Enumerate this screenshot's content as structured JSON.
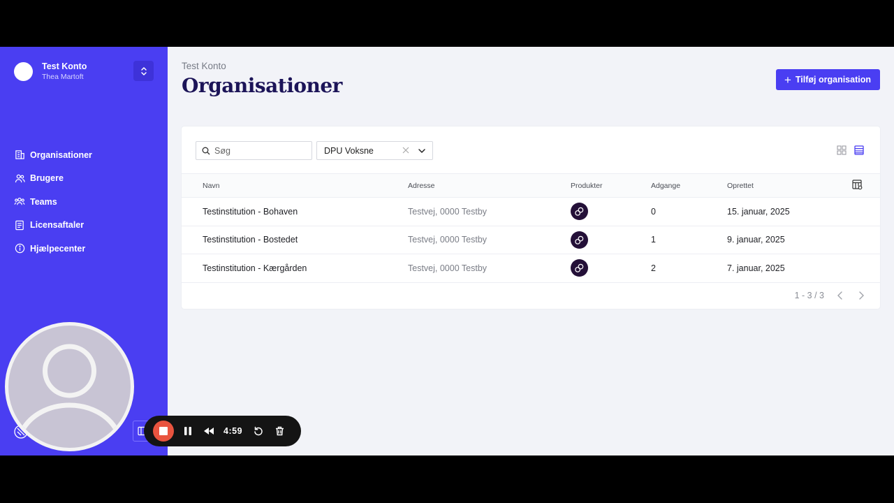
{
  "account": {
    "name": "Test Konto",
    "user": "Thea Martoft"
  },
  "nav": [
    {
      "label": "Organisationer",
      "icon": "building-icon"
    },
    {
      "label": "Brugere",
      "icon": "users-icon"
    },
    {
      "label": "Teams",
      "icon": "team-icon"
    },
    {
      "label": "Licensaftaler",
      "icon": "document-icon"
    },
    {
      "label": "Hjælpecenter",
      "icon": "info-icon"
    }
  ],
  "header": {
    "breadcrumb": "Test Konto",
    "title": "Organisationer",
    "add_button": "Tilføj organisation"
  },
  "toolbar": {
    "search_placeholder": "Søg",
    "filter_value": "DPU Voksne"
  },
  "table": {
    "columns": [
      "Navn",
      "Adresse",
      "Produkter",
      "Adgange",
      "Oprettet"
    ],
    "rows": [
      {
        "name": "Testinstitution - Bohaven",
        "address": "Testvej, 0000 Testby",
        "access": "0",
        "created": "15. januar, 2025"
      },
      {
        "name": "Testinstitution - Bostedet",
        "address": "Testvej, 0000 Testby",
        "access": "1",
        "created": "9. januar, 2025"
      },
      {
        "name": "Testinstitution - Kærgården",
        "address": "Testvej, 0000 Testby",
        "access": "2",
        "created": "7. januar, 2025"
      }
    ]
  },
  "pagination": {
    "range": "1 - 3 / 3"
  },
  "recorder": {
    "time": "4:59"
  },
  "colors": {
    "accent": "#4a3ef2",
    "title": "#1c1458",
    "product_badge": "#241038",
    "record": "#e9543f"
  }
}
